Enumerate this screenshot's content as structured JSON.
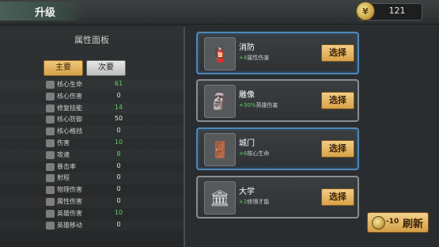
{
  "header": {
    "title": "升级",
    "currency": {
      "icon": "coin-icon",
      "value": "121"
    }
  },
  "left_panel": {
    "title": "属性面板",
    "tabs": {
      "main": "主要",
      "secondary": "次要"
    },
    "stats": [
      {
        "name": "核心生命",
        "value": "61",
        "highlight": true,
        "icon": "heart-icon"
      },
      {
        "name": "核心伤害",
        "value": "0",
        "highlight": false,
        "icon": "sword-icon"
      },
      {
        "name": "修复技能",
        "value": "14",
        "highlight": true,
        "icon": "wrench-icon"
      },
      {
        "name": "核心防御",
        "value": "50",
        "highlight": false,
        "icon": "shield-icon"
      },
      {
        "name": "核心格挡",
        "value": "0",
        "highlight": false,
        "icon": "block-icon"
      },
      {
        "name": "伤害",
        "value": "10",
        "highlight": true,
        "icon": "damage-icon"
      },
      {
        "name": "攻速",
        "value": "8",
        "highlight": true,
        "icon": "speed-icon"
      },
      {
        "name": "暴击率",
        "value": "0",
        "highlight": false,
        "icon": "crit-icon"
      },
      {
        "name": "射程",
        "value": "0",
        "highlight": false,
        "icon": "range-icon"
      },
      {
        "name": "物理伤害",
        "value": "0",
        "highlight": false,
        "icon": "physical-icon"
      },
      {
        "name": "属性伤害",
        "value": "0",
        "highlight": false,
        "icon": "element-icon"
      },
      {
        "name": "英雄伤害",
        "value": "10",
        "highlight": true,
        "icon": "hero-damage-icon"
      },
      {
        "name": "英雄移动",
        "value": "0",
        "highlight": false,
        "icon": "boot-icon"
      }
    ]
  },
  "cards": [
    {
      "name": "消防",
      "bonus": "+4",
      "desc": "属性伤害",
      "button": "选择",
      "border": "blue",
      "icon": "fire-station-icon"
    },
    {
      "name": "雕像",
      "bonus": "+30%",
      "desc": "英雄伤害",
      "button": "选择",
      "border": "gray",
      "icon": "statue-icon"
    },
    {
      "name": "城门",
      "bonus": "+6",
      "desc": "核心生命",
      "button": "选择",
      "border": "blue",
      "icon": "gate-icon"
    },
    {
      "name": "大学",
      "bonus": "+2",
      "desc": "修理才能",
      "button": "选择",
      "border": "gray",
      "icon": "university-icon"
    }
  ],
  "refresh": {
    "cost": "-10",
    "label": "刷新",
    "icon": "coin-icon"
  }
}
